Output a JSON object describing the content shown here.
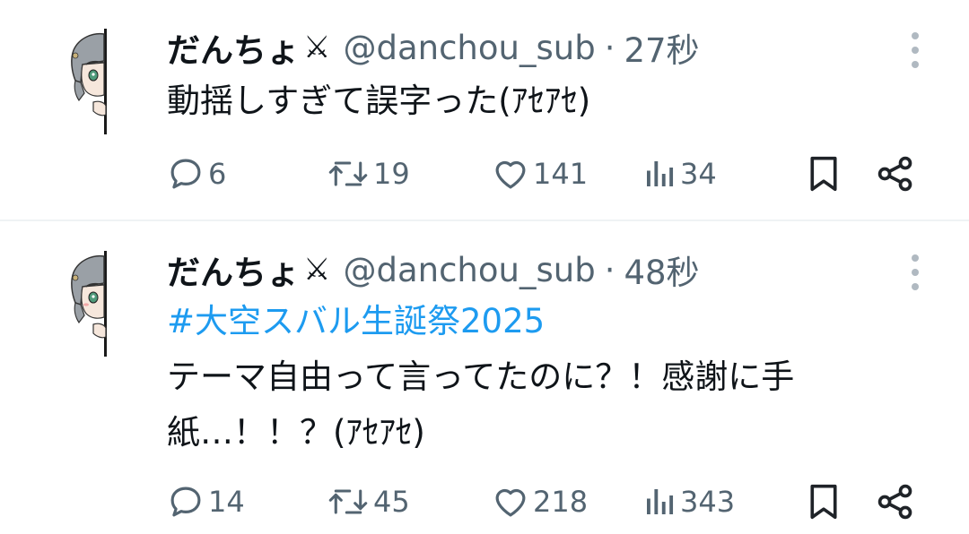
{
  "tweets": [
    {
      "display_name": "だんちょ",
      "name_mark": "⚔",
      "handle": "@danchou_sub",
      "separator": "·",
      "time": "27秒",
      "text": "動揺しすぎて誤字った(ｱｾｱｾ)",
      "stats": {
        "replies": "6",
        "retweets": "19",
        "likes": "141",
        "views": "34"
      }
    },
    {
      "display_name": "だんちょ",
      "name_mark": "⚔",
      "handle": "@danchou_sub",
      "separator": "·",
      "time": "48秒",
      "hashtag": "#大空スバル生誕祭2025",
      "text_lines": [
        "テーマ自由って言ってたのに？！感謝に手",
        "紙…！！？(ｱｾｱｾ)"
      ],
      "stats": {
        "replies": "14",
        "retweets": "45",
        "likes": "218",
        "views": "343"
      }
    }
  ],
  "icons": {
    "reply": "speech-bubble-icon",
    "retweet": "retweet-arrows-icon",
    "like": "heart-icon",
    "views": "bar-chart-icon",
    "bookmark": "bookmark-icon",
    "share": "share-nodes-icon",
    "more": "vertical-dots-icon"
  },
  "colors": {
    "text": "#0f1419",
    "secondary": "#536471",
    "hashtag": "#1d9bf0",
    "divider": "#eff3f4"
  }
}
